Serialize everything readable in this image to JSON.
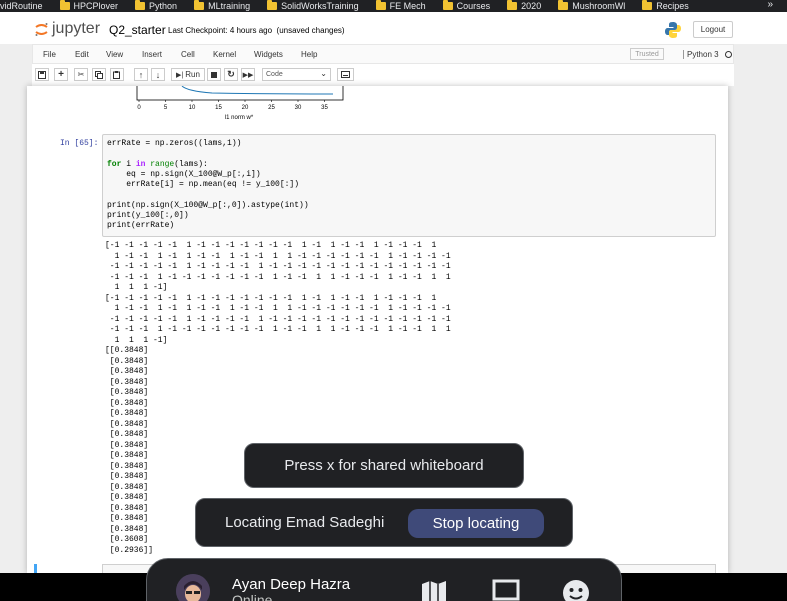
{
  "bookmarks": {
    "items": [
      "vidRoutine",
      "HPCPlover",
      "Python",
      "MLtraining",
      "SolidWorksTraining",
      "FE Mech",
      "Courses",
      "2020",
      "MushroomWl",
      "Recipes"
    ],
    "more": "»"
  },
  "header": {
    "brand": "jupyter",
    "notebook_title": "Q2_starter",
    "checkpoint": "Last Checkpoint: 4 hours ago",
    "unsaved": "(unsaved changes)",
    "logout_label": "Logout"
  },
  "menubar": {
    "items": [
      "File",
      "Edit",
      "View",
      "Insert",
      "Cell",
      "Kernel",
      "Widgets",
      "Help"
    ],
    "trusted": "Trusted",
    "kernel": "Python 3"
  },
  "toolbar": {
    "run_label": "Run",
    "cell_type": "Code"
  },
  "plot": {
    "x_ticks": [
      "0",
      "5",
      "10",
      "15",
      "20",
      "25",
      "30",
      "35"
    ],
    "xlabel": "l1 norm w*"
  },
  "cell": {
    "prompt": "In [65]:",
    "code": {
      "l1": "errRate = np.zeros((lams,1))",
      "l2_kw": "for",
      "l2_var": " i ",
      "l2_in": "in",
      "l2_fn": " range",
      "l2_rest": "(lams):",
      "l3": "    eq = np.sign(X_100@W_p[:,i])",
      "l4": "    errRate[i] = np.mean(eq != y_100[:])",
      "l5": "print(np.sign(X_100@W_p[:,0]).astype(int))",
      "l6": "print(y_100[:,0])",
      "l7": "print(errRate)"
    }
  },
  "output": {
    "lines": [
      "[-1 -1 -1 -1 -1  1 -1 -1 -1 -1 -1 -1 -1  1 -1  1 -1 -1  1 -1 -1 -1  1",
      "  1 -1 -1  1 -1  1 -1 -1  1 -1 -1  1  1 -1 -1 -1 -1 -1 -1  1 -1 -1 -1 -1",
      " -1 -1 -1 -1 -1  1 -1 -1 -1 -1  1 -1 -1 -1 -1 -1 -1 -1 -1 -1 -1 -1 -1 -1",
      " -1 -1 -1  1 -1 -1 -1 -1 -1 -1 -1  1 -1 -1  1  1 -1 -1 -1  1 -1 -1  1  1",
      "  1  1  1 -1]",
      "[-1 -1 -1 -1 -1  1 -1 -1 -1 -1 -1 -1 -1  1 -1  1 -1 -1  1 -1 -1 -1  1",
      "  1 -1 -1  1 -1  1 -1 -1  1 -1 -1  1  1 -1 -1 -1 -1 -1 -1  1 -1 -1 -1 -1",
      " -1 -1 -1 -1 -1  1 -1 -1 -1 -1  1 -1 -1 -1 -1 -1 -1 -1 -1 -1 -1 -1 -1 -1",
      " -1 -1 -1  1 -1 -1 -1 -1 -1 -1 -1  1 -1 -1  1  1 -1 -1 -1  1 -1 -1  1  1",
      "  1  1  1 -1]",
      "[[0.3848]",
      " [0.3848]",
      " [0.3848]",
      " [0.3848]",
      " [0.3848]",
      " [0.3848]",
      " [0.3848]",
      " [0.3848]",
      " [0.3848]",
      " [0.3848]",
      " [0.3848]",
      " [0.3848]",
      " [0.3848]",
      " [0.3848]",
      " [0.3848]",
      " [0.3848]",
      " [0.3848]",
      " [0.3848]",
      " [0.3608]",
      " [0.2936]]"
    ]
  },
  "overlays": {
    "whiteboard": "Press x for shared whiteboard",
    "locating": "Locating Emad Sadeghi",
    "stop_locating": "Stop locating"
  },
  "call": {
    "name": "Ayan Deep Hazra",
    "status": "Online"
  }
}
